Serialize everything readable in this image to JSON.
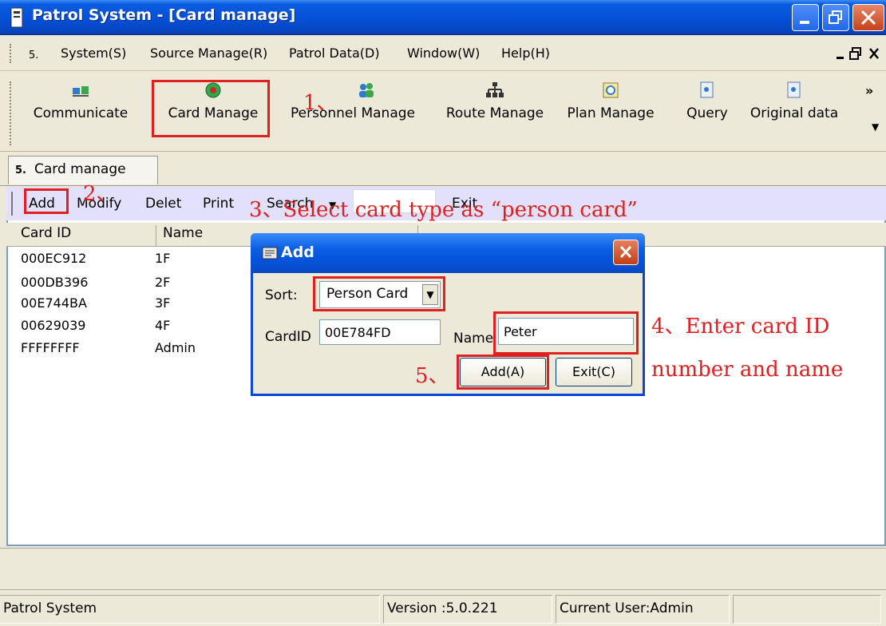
{
  "window": {
    "title": "Patrol System - [Card manage]"
  },
  "menu": {
    "items": [
      "System(S)",
      "Source Manage(R)",
      "Patrol Data(D)",
      "Window(W)",
      "Help(H)"
    ],
    "mdi_buttons": [
      "_",
      "ə",
      "x"
    ]
  },
  "toolbar": {
    "buttons": [
      {
        "label": "Communicate",
        "icon": "communicate-icon"
      },
      {
        "label": "Card Manage",
        "icon": "card-icon"
      },
      {
        "label": "Personnel Manage",
        "icon": "people-icon"
      },
      {
        "label": "Route Manage",
        "icon": "route-icon"
      },
      {
        "label": "Plan Manage",
        "icon": "plan-icon"
      },
      {
        "label": "Query",
        "icon": "query-icon"
      },
      {
        "label": "Original data",
        "icon": "original-data-icon"
      }
    ],
    "more": "»"
  },
  "tab": {
    "label": "Card manage"
  },
  "sub_toolbar": {
    "add": "Add",
    "modify": "Modify",
    "delet": "Delet",
    "print": "Print",
    "search": "Search",
    "exit": "Exit"
  },
  "table": {
    "headers": [
      "Card ID",
      "Name"
    ],
    "rows": [
      {
        "id": "000EC912",
        "name": "1F"
      },
      {
        "id": "000DB396",
        "name": "2F"
      },
      {
        "id": "00E744BA",
        "name": "3F"
      },
      {
        "id": "00629039",
        "name": "4F"
      },
      {
        "id": "FFFFFFFF",
        "name": "Admin"
      }
    ]
  },
  "dialog": {
    "title": "Add",
    "sort_label": "Sort:",
    "sort_value": "Person Card",
    "cardid_label": "CardID",
    "cardid_value": "00E784FD",
    "name_label": "Name",
    "name_value": "Peter",
    "add_button": "Add(A)",
    "exit_button": "Exit(C)"
  },
  "annotations": {
    "step1": "1、",
    "step2": "2、",
    "step3": "3、Select card type as “person card”",
    "step4_line1": "4、Enter card ID",
    "step4_line2": "number and name",
    "step5": "5、"
  },
  "status": {
    "app": "Patrol System",
    "version": "Version :5.0.221",
    "user": "Current User:Admin"
  },
  "colors": {
    "title_blue": "#0651d8",
    "annotation_red": "#e02020",
    "sub_toolbar_bg": "#e2e0fa"
  }
}
